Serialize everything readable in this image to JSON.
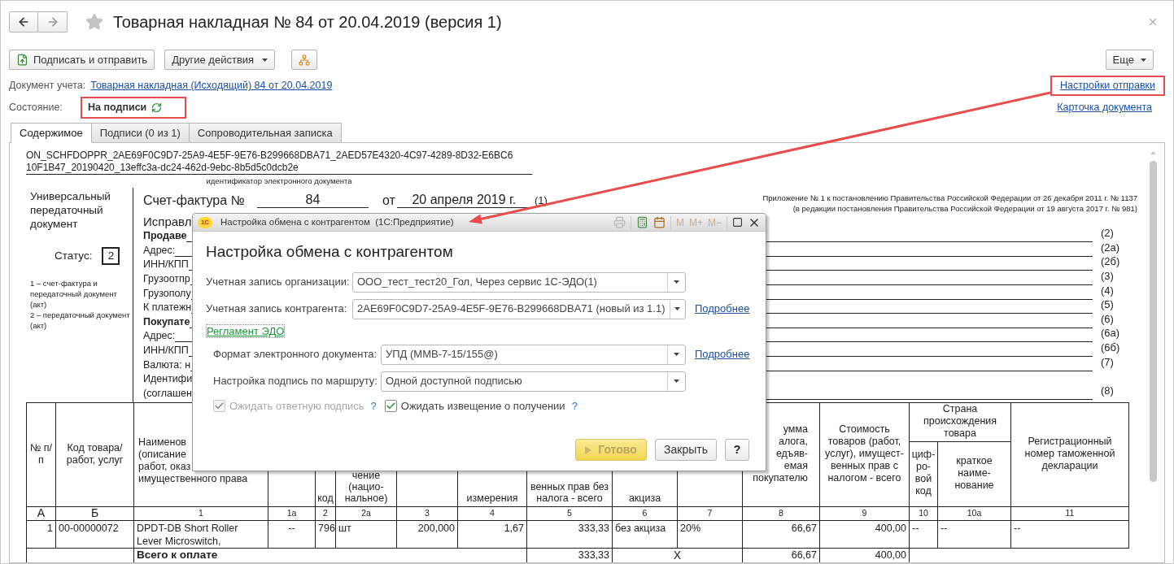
{
  "window": {
    "title": "Товарная накладная № 84 от 20.04.2019 (версия 1)",
    "favorite": false
  },
  "toolbar": {
    "buttons": [
      {
        "kind": "send",
        "label": "Подписать и отправить"
      },
      {
        "kind": "menu",
        "label": "Другие действия"
      },
      {
        "kind": "structure"
      }
    ],
    "more": "Еще"
  },
  "document_account": {
    "label": "Документ учета:",
    "link": "Товарная накладная (Исходящий) 84 от 20.04.2019"
  },
  "state": {
    "label": "Состояние:",
    "value": "На подписи",
    "highlighted": true
  },
  "links": [
    {
      "label": "Настройки отправки",
      "highlighted": true
    },
    {
      "label": "Карточка документа",
      "highlighted": false
    }
  ],
  "tabs": [
    {
      "label": "Содержимое",
      "selected": true
    },
    {
      "label": "Подписи (0 из 1)",
      "selected": false
    },
    {
      "label": "Сопроводительная записка",
      "selected": false
    }
  ],
  "document": {
    "id_lines": [
      "ON_SCHFDOPPR_2AE69F0C9D7-25A9-4E5F-9E76-B299668DBA71_2AED57E4320-4C97-4289-8D32-E6BC6",
      "10F1B47_20190420_13effc3a-dc24-462d-9ebc-8b5d5c0dcb2e"
    ],
    "id_caption": "идентификатор электронного документа",
    "doc_type": "Универсальный передаточный документ",
    "status_label": "Статус:",
    "status_value": "2",
    "status_legend": [
      "1 – счет-фактура и передаточный документ (акт)",
      "2 – передаточный документ (акт)"
    ],
    "invoice": {
      "label": "Счет-фактура №",
      "number": "84",
      "from": "от",
      "date": "20 апреля 2019 г.",
      "code": "(1)"
    },
    "appendix": [
      "Приложение № 1 к постановлению Правительства Российской Федерации от 26 декабря 2011 г. № 1137",
      "(в редакции постановления Правительства Российской Федерации от 19 августа 2017 г. № 981)"
    ],
    "fields": [
      {
        "label": "Исправл",
        "bold": false
      },
      {
        "label": "Продаве",
        "bold": true,
        "code": "(2)"
      },
      {
        "label": "Адрес:",
        "bold": false,
        "code": "(2а)"
      },
      {
        "label": "ИНН/КПП",
        "bold": false,
        "code": "(2б)"
      },
      {
        "label": "Грузоотпр",
        "bold": false,
        "code": "(3)"
      },
      {
        "label": "Грузополу",
        "bold": false,
        "code": "(4)"
      },
      {
        "label": "К платежн",
        "bold": false,
        "code": "(5)"
      },
      {
        "label": "Покупате",
        "bold": true,
        "code": "(6)"
      },
      {
        "label": "Адрес:",
        "bold": false,
        "code": "(6а)"
      },
      {
        "label": "ИНН/КПП",
        "bold": false,
        "code": "(6б)"
      },
      {
        "label": "Валюта: н",
        "bold": false,
        "code": "(7)"
      },
      {
        "label": "Идентифи",
        "bold": false
      },
      {
        "label": "(соглашен",
        "bold": false,
        "code": "(8)"
      }
    ],
    "table": {
      "group": "Страна происхождения товара",
      "columns": [
        {
          "head": "№ п/п",
          "num": "А"
        },
        {
          "head": "Код товара/ работ, услуг",
          "num": "Б"
        },
        {
          "head": "Наименов\n(описание\nработ, оказ\nимущественного права",
          "num": "1"
        },
        {
          "num": "1а"
        },
        {
          "head": "код",
          "num": "2"
        },
        {
          "head": "чение\n(нацио-\nнальное)",
          "num": "2а"
        },
        {
          "num": "3"
        },
        {
          "head": "измерения",
          "num": "4"
        },
        {
          "head": "венных прав без\nналога - всего",
          "num": "5"
        },
        {
          "head": "акциза",
          "num": "6"
        },
        {
          "num": "7"
        },
        {
          "head": "умма\nалога,\nедъяв-\nемая\nпокупателю",
          "num": "8"
        },
        {
          "head": "Стоимость товаров (работ, услуг), имущест- венных прав с налогом - всего",
          "num": "9"
        },
        {
          "head": "циф- ро- вой код",
          "num": "10",
          "in_group": true
        },
        {
          "head": "краткое наиме- нование",
          "num": "10а",
          "in_group": true
        },
        {
          "head": "Регистрационный номер таможенной декларации",
          "num": "11"
        }
      ],
      "rows": [
        [
          "1",
          "00-00000072",
          "DPDT-DB Short Roller Lever Microswitch,",
          "--",
          "796",
          "шт",
          "200,000",
          "1,67",
          "333,33",
          "без акциза",
          "20%",
          "66,67",
          "400,00",
          "--",
          "--",
          "--"
        ]
      ],
      "total": {
        "label": "Всего к оплате",
        "without_tax": "333,33",
        "excise": "X",
        "tax": "66,67",
        "with_tax": "400,00"
      }
    }
  },
  "dialog": {
    "logo": "1С",
    "title": "Настройка обмена с контрагентом  (1С:Предприятие)",
    "memory_buttons": [
      "M",
      "M+",
      "M−"
    ],
    "heading": "Настройка обмена с контрагентом",
    "fields": [
      {
        "label": "Учетная запись организации:",
        "value": "ООО_тест_тест20_Гол, Через сервис 1С-ЭДО(1)"
      },
      {
        "label": "Учетная запись контрагента:",
        "value": "2AE69F0C9D7-25A9-4E5F-9E76-B299668DBA71 (новый из 1.1)",
        "link": "Подробнее"
      }
    ],
    "section_link": "Регламент ЭДО",
    "section_fields": [
      {
        "label": "Формат электронного документа:",
        "value": "УПД (ММВ-7-15/155@)",
        "link": "Подробнее"
      },
      {
        "label": "Настройка подпись по маршруту:",
        "value": "Одной доступной подписью"
      }
    ],
    "checkboxes": [
      {
        "label": "Ожидать ответную подпись",
        "checked": true,
        "disabled": true,
        "help": "?"
      },
      {
        "label": "Ожидать извещение о получении",
        "checked": true,
        "disabled": false,
        "help": "?"
      }
    ],
    "buttons": [
      {
        "kind": "primary",
        "label": "Готово",
        "disabled": true
      },
      {
        "kind": "default",
        "label": "Закрыть",
        "disabled": false
      },
      {
        "kind": "help",
        "label": "?",
        "disabled": false
      }
    ]
  }
}
